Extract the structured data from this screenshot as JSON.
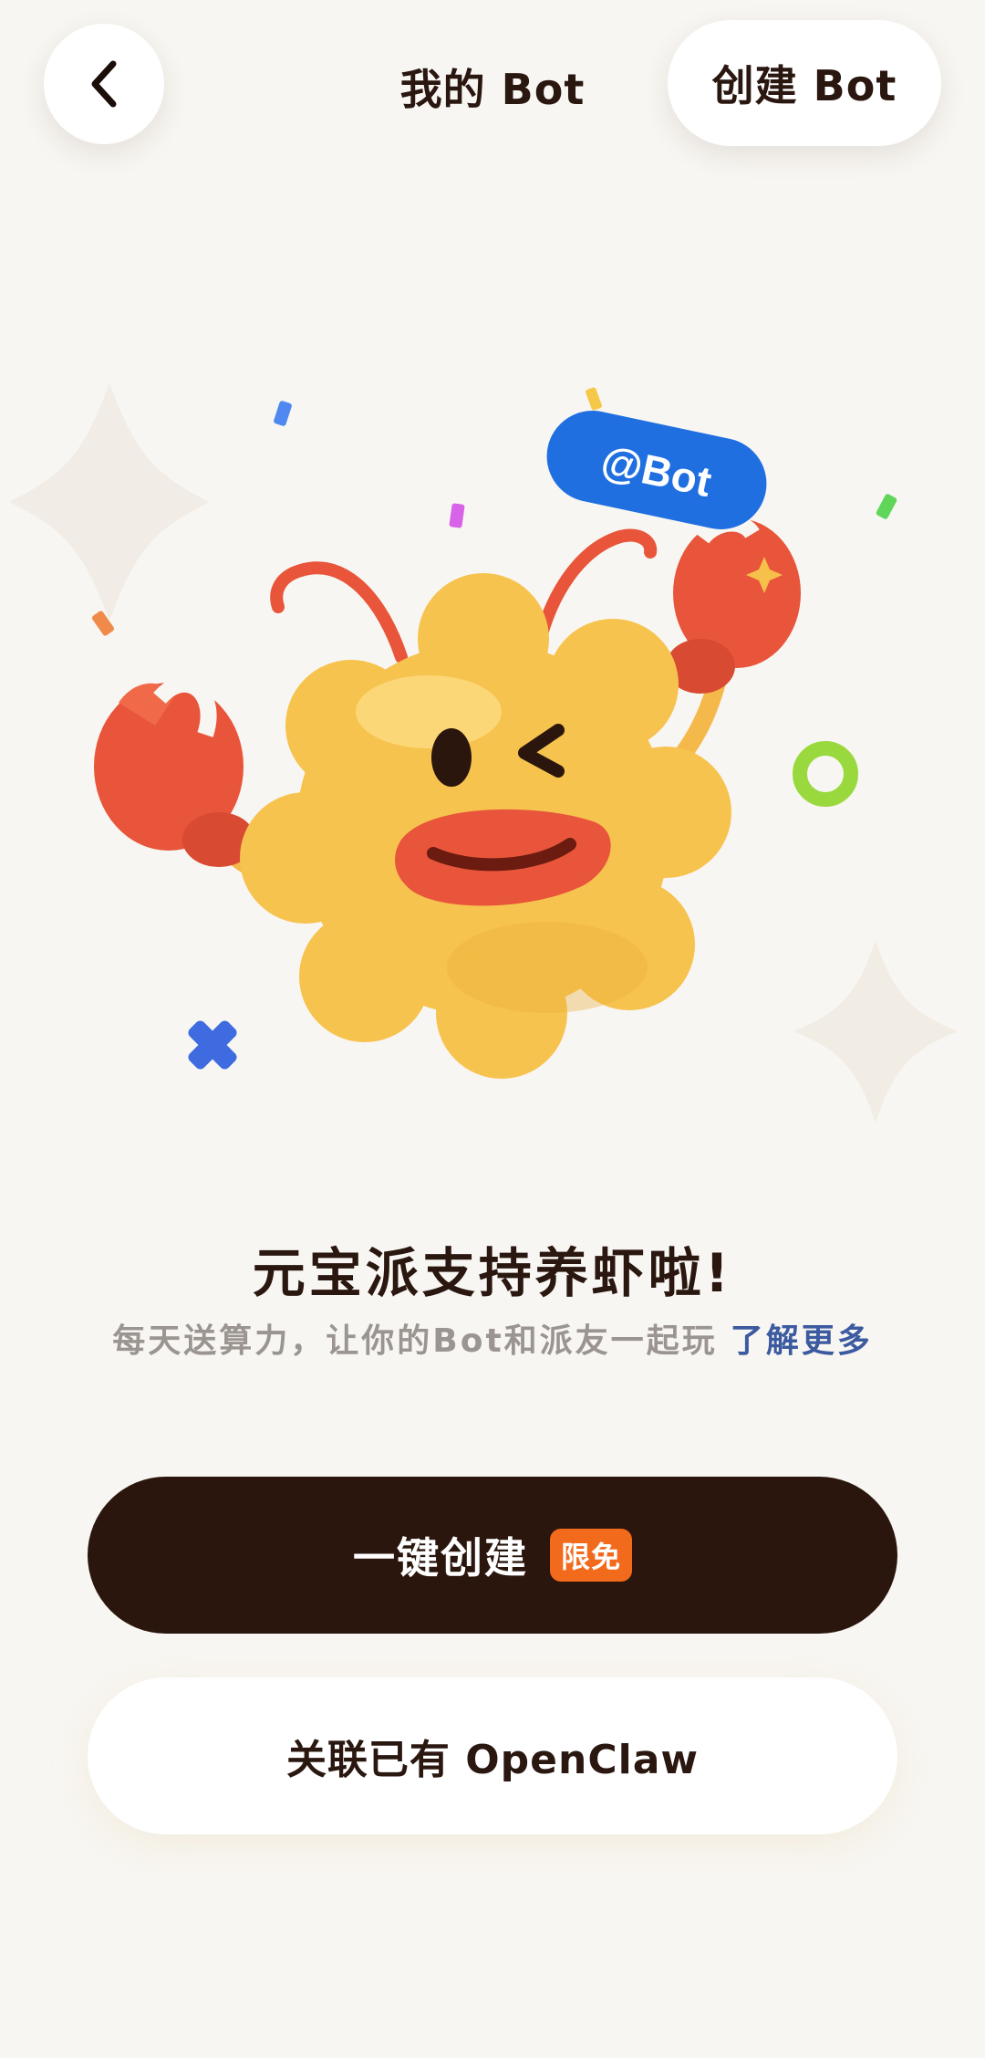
{
  "header": {
    "title": "我的 Bot",
    "create_label": "创建 Bot",
    "back_icon": "chevron-left-icon"
  },
  "hero": {
    "badge_text": "@Bot",
    "mascot": "smiling-crab-mascot"
  },
  "content": {
    "headline": "元宝派支持养虾啦!",
    "subline": "每天送算力，让你的Bot和派友一起玩",
    "learn_more": "了解更多"
  },
  "actions": {
    "one_click_create": "一键创建",
    "free_tag": "限免",
    "link_existing": "关联已有 OpenClaw"
  },
  "colors": {
    "background": "#f8f6f2",
    "primary_button": "#2a160d",
    "free_tag": "#f26a1c",
    "link": "#3c5aa0",
    "mascot_body": "#f7c34f",
    "mascot_claw": "#e8553a",
    "badge": "#1f6fe0"
  }
}
